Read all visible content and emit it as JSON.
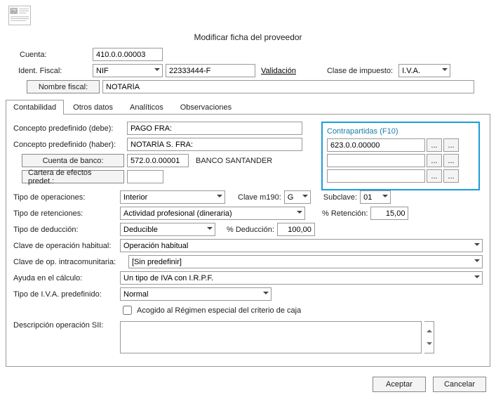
{
  "window": {
    "title": "Modificar ficha del proveedor"
  },
  "header": {
    "cuenta_label": "Cuenta:",
    "cuenta_value": "410.0.0.00003",
    "ident_label": "Ident. Fiscal:",
    "ident_tipo": "NIF",
    "ident_valor": "22333444-F",
    "validacion": "Validación",
    "clase_impuesto_label": "Clase de impuesto:",
    "clase_impuesto": "I.V.A.",
    "nombre_fiscal_label": "Nombre fiscal:",
    "nombre_fiscal": "NOTARÍA"
  },
  "tabs": {
    "contabilidad": "Contabilidad",
    "otros": "Otros datos",
    "analiticos": "Analíticos",
    "observaciones": "Observaciones"
  },
  "contabilidad": {
    "concepto_debe_label": "Concepto predefinido (debe):",
    "concepto_debe": "PAGO FRA:",
    "concepto_haber_label": "Concepto predefinido (haber):",
    "concepto_haber": "NOTARÍA S. FRA:",
    "cuenta_banco_label": "Cuenta de banco:",
    "cuenta_banco": "572.0.0.00001",
    "cuenta_banco_nombre": "BANCO SANTANDER",
    "cartera_label": "Cartera de efectos predet.:",
    "cartera": "",
    "tipo_operaciones_label": "Tipo de operaciones:",
    "tipo_operaciones": "Interior",
    "clave_m190_label": "Clave m190:",
    "clave_m190": "G",
    "subclave_label": "Subclave:",
    "subclave": "01",
    "tipo_retenciones_label": "Tipo de retenciones:",
    "tipo_retenciones": "Actividad profesional (dineraria)",
    "pct_retencion_label": "% Retención:",
    "pct_retencion": "15,00",
    "tipo_deduccion_label": "Tipo de deducción:",
    "tipo_deduccion": "Deducible",
    "pct_deduccion_label": "% Deducción:",
    "pct_deduccion": "100,00",
    "clave_op_habitual_label": "Clave de operación habitual:",
    "clave_op_habitual": "Operación habitual",
    "clave_op_intra_label": "Clave de op. intracomunitaria:",
    "clave_op_intra": "[Sin predefinir]",
    "ayuda_calculo_label": "Ayuda en el cálculo:",
    "ayuda_calculo": "Un tipo de IVA con I.R.P.F.",
    "tipo_iva_label": "Tipo de I.V.A. predefinido:",
    "tipo_iva": "Normal",
    "check_criterio": "Acogido al Régimen especial del criterio de caja",
    "descr_sii_label": "Descripción operación SII:",
    "descr_sii": "",
    "contrap_title": "Contrapartidas (F10)",
    "contrap": [
      "623.0.0.00000",
      "",
      ""
    ],
    "dots": "..."
  },
  "footer": {
    "aceptar": "Aceptar",
    "cancelar": "Cancelar"
  }
}
